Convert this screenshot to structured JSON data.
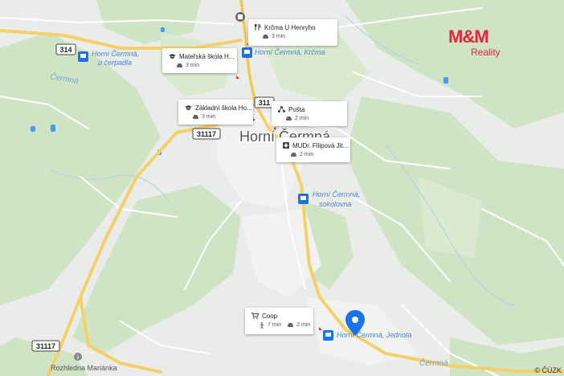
{
  "map": {
    "town_label": "Horní Čermná",
    "place_labels": {
      "cermna_upper": "Čermná",
      "cermna_lower": "Čermná",
      "rozhledna": "Rozhledna Mariánka"
    },
    "road_shields": {
      "r314": "314",
      "r311": "311",
      "r31117_a": "31117",
      "r31117_b": "31117"
    },
    "bus_stops": {
      "cerpadla": [
        "Horní Čermná,",
        "u čerpadla"
      ],
      "krcma": "Horní Čermná, Krčma",
      "sokolovna": [
        "Horní Čermná,",
        "sokolovna"
      ],
      "jednota": "Horní Čermná, Jednota"
    },
    "colors": {
      "water_blue": "#4a9be8",
      "road_yellow": "#f5cf6a",
      "marker_blue": "#1a73e8",
      "brand_red": "#e6243a"
    }
  },
  "pois": {
    "krcma": {
      "name": "Krčma U Henryho",
      "drive": "3 min"
    },
    "materska": {
      "name": "Mateřská škola H...",
      "drive": "3 min"
    },
    "zakladni": {
      "name": "Základní škola Ho...",
      "drive": "3 min"
    },
    "posta": {
      "name": "Pošta",
      "drive": "2 min"
    },
    "mudr": {
      "name": "MUDr. Filipová Jit...",
      "drive": "2 min"
    },
    "coop": {
      "name": "Coop",
      "walk": "7 min",
      "drive": "2 min"
    }
  },
  "brand": {
    "mm": "M&M",
    "reality": "Reality"
  },
  "copyright": "© ČÚZK"
}
